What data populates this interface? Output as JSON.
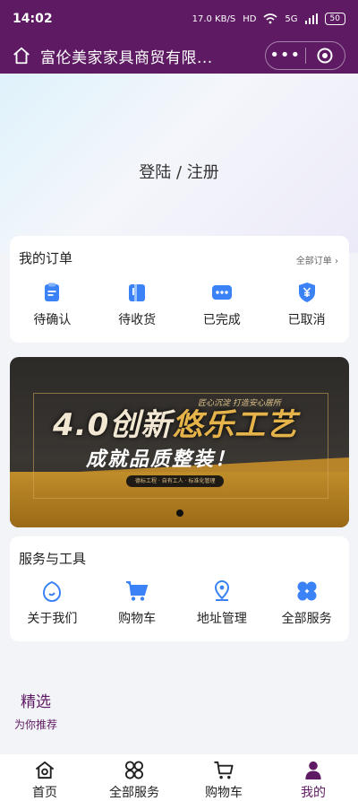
{
  "status": {
    "time": "14:02",
    "speed": "17.0 KB/S",
    "hd": "HD",
    "net": "5G",
    "battery": "50"
  },
  "header": {
    "title": "富伦美家家具商贸有限..."
  },
  "hero": {
    "login_text": "登陆 / 注册"
  },
  "orders": {
    "title": "我的订单",
    "all_link": "全部订单 ›",
    "items": [
      {
        "label": "待确认",
        "icon": "clipboard-icon"
      },
      {
        "label": "待收货",
        "icon": "package-icon"
      },
      {
        "label": "已完成",
        "icon": "chat-dots-icon"
      },
      {
        "label": "已取消",
        "icon": "yen-shield-icon"
      }
    ]
  },
  "banner": {
    "headline_a": "4.0创新",
    "headline_b": "悠乐工艺",
    "tagline": "匠心沉淀 打造安心居所",
    "subline": "成就品质整装！",
    "pill": "德标工程 · 自有工人 · 标准化管理"
  },
  "tools": {
    "title": "服务与工具",
    "items": [
      {
        "label": "关于我们",
        "icon": "drop-face-icon"
      },
      {
        "label": "购物车",
        "icon": "cart-icon"
      },
      {
        "label": "地址管理",
        "icon": "location-pin-icon"
      },
      {
        "label": "全部服务",
        "icon": "grid-flower-icon"
      }
    ]
  },
  "featured": {
    "title": "精选",
    "subtitle": "为你推荐"
  },
  "tabbar": [
    {
      "label": "首页",
      "icon": "home-icon"
    },
    {
      "label": "全部服务",
      "icon": "services-icon"
    },
    {
      "label": "购物车",
      "icon": "cart-icon"
    },
    {
      "label": "我的",
      "icon": "user-icon",
      "active": true
    }
  ],
  "colors": {
    "brand": "#5e1a63",
    "accent": "#3b82f6"
  }
}
